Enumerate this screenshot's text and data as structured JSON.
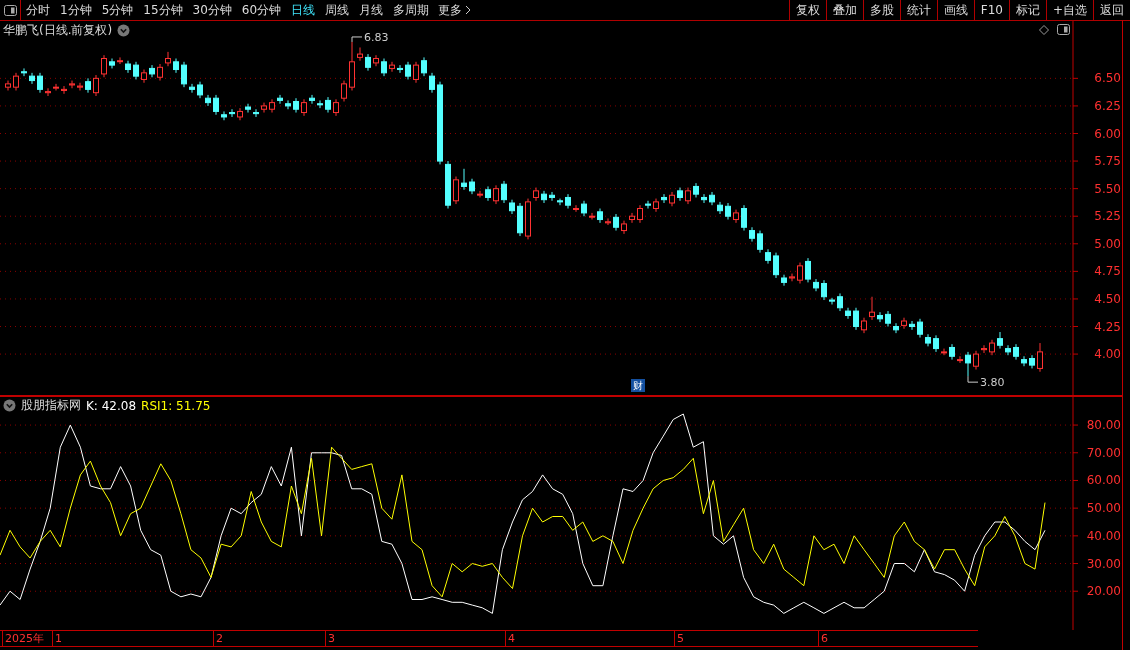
{
  "toolbar": {
    "periods": [
      {
        "label": "分时",
        "selected": false
      },
      {
        "label": "1分钟",
        "selected": false
      },
      {
        "label": "5分钟",
        "selected": false
      },
      {
        "label": "15分钟",
        "selected": false
      },
      {
        "label": "30分钟",
        "selected": false
      },
      {
        "label": "60分钟",
        "selected": false
      },
      {
        "label": "日线",
        "selected": true
      },
      {
        "label": "周线",
        "selected": false
      },
      {
        "label": "月线",
        "selected": false
      },
      {
        "label": "多周期",
        "selected": false
      }
    ],
    "more": "更多",
    "buttons": [
      "复权",
      "叠加",
      "多股",
      "统计",
      "画线",
      "F10",
      "标记",
      "+自选",
      "返回"
    ]
  },
  "price_panel": {
    "title": "华鹏飞(日线.前复权)",
    "high_label": "6.83",
    "low_label": "3.80",
    "badge": "财",
    "chart_data": {
      "type": "candlestick",
      "ylim": [
        3.62,
        7.02
      ],
      "grid": true,
      "yticks": [
        {
          "value": 6.5,
          "label": "6.50"
        },
        {
          "value": 6.25,
          "label": "6.25"
        },
        {
          "value": 6.0,
          "label": "6.00"
        },
        {
          "value": 5.75,
          "label": "5.75"
        },
        {
          "value": 5.5,
          "label": "5.50"
        },
        {
          "value": 5.25,
          "label": "5.25"
        },
        {
          "value": 5.0,
          "label": "5.00"
        },
        {
          "value": 4.75,
          "label": "4.75"
        },
        {
          "value": 4.5,
          "label": "4.50"
        },
        {
          "value": 4.25,
          "label": "4.25"
        },
        {
          "value": 4.0,
          "label": "4.00"
        }
      ],
      "ohlc": [
        [
          6.42,
          6.48,
          6.39,
          6.45
        ],
        [
          6.42,
          6.55,
          6.39,
          6.52
        ],
        [
          6.56,
          6.59,
          6.52,
          6.55
        ],
        [
          6.52,
          6.55,
          6.45,
          6.48
        ],
        [
          6.52,
          6.55,
          6.37,
          6.4
        ],
        [
          6.37,
          6.41,
          6.34,
          6.38
        ],
        [
          6.42,
          6.45,
          6.39,
          6.42
        ],
        [
          6.39,
          6.43,
          6.36,
          6.4
        ],
        [
          6.44,
          6.48,
          6.41,
          6.45
        ],
        [
          6.42,
          6.46,
          6.39,
          6.43
        ],
        [
          6.47,
          6.5,
          6.37,
          6.4
        ],
        [
          6.37,
          6.53,
          6.34,
          6.5
        ],
        [
          6.54,
          6.71,
          6.51,
          6.68
        ],
        [
          6.65,
          6.68,
          6.59,
          6.62
        ],
        [
          6.66,
          6.69,
          6.63,
          6.66
        ],
        [
          6.63,
          6.66,
          6.55,
          6.58
        ],
        [
          6.62,
          6.65,
          6.49,
          6.52
        ],
        [
          6.49,
          6.58,
          6.46,
          6.55
        ],
        [
          6.59,
          6.62,
          6.51,
          6.54
        ],
        [
          6.51,
          6.63,
          6.48,
          6.6
        ],
        [
          6.64,
          6.74,
          6.61,
          6.68
        ],
        [
          6.65,
          6.68,
          6.55,
          6.58
        ],
        [
          6.62,
          6.65,
          6.42,
          6.45
        ],
        [
          6.42,
          6.45,
          6.37,
          6.4
        ],
        [
          6.44,
          6.47,
          6.32,
          6.35
        ],
        [
          6.32,
          6.35,
          6.25,
          6.28
        ],
        [
          6.32,
          6.35,
          6.17,
          6.2
        ],
        [
          6.17,
          6.2,
          6.12,
          6.15
        ],
        [
          6.19,
          6.22,
          6.15,
          6.18
        ],
        [
          6.15,
          6.23,
          6.12,
          6.2
        ],
        [
          6.24,
          6.27,
          6.19,
          6.22
        ],
        [
          6.19,
          6.22,
          6.15,
          6.18
        ],
        [
          6.22,
          6.28,
          6.19,
          6.25
        ],
        [
          6.22,
          6.31,
          6.19,
          6.28
        ],
        [
          6.32,
          6.35,
          6.27,
          6.3
        ],
        [
          6.27,
          6.3,
          6.22,
          6.25
        ],
        [
          6.29,
          6.32,
          6.19,
          6.22
        ],
        [
          6.19,
          6.31,
          6.16,
          6.28
        ],
        [
          6.32,
          6.35,
          6.27,
          6.3
        ],
        [
          6.27,
          6.3,
          6.23,
          6.26
        ],
        [
          6.3,
          6.33,
          6.19,
          6.22
        ],
        [
          6.19,
          6.31,
          6.16,
          6.28
        ],
        [
          6.32,
          6.48,
          6.29,
          6.45
        ],
        [
          6.42,
          6.83,
          6.39,
          6.65
        ],
        [
          6.69,
          6.78,
          6.66,
          6.72
        ],
        [
          6.69,
          6.72,
          6.57,
          6.6
        ],
        [
          6.64,
          6.71,
          6.61,
          6.68
        ],
        [
          6.65,
          6.68,
          6.52,
          6.55
        ],
        [
          6.59,
          6.65,
          6.56,
          6.62
        ],
        [
          6.59,
          6.62,
          6.55,
          6.58
        ],
        [
          6.62,
          6.65,
          6.49,
          6.52
        ],
        [
          6.49,
          6.65,
          6.46,
          6.62
        ],
        [
          6.66,
          6.69,
          6.52,
          6.55
        ],
        [
          6.52,
          6.55,
          6.37,
          6.4
        ],
        [
          6.44,
          6.47,
          5.72,
          5.75
        ],
        [
          5.72,
          5.75,
          5.32,
          5.35
        ],
        [
          5.39,
          5.61,
          5.36,
          5.58
        ],
        [
          5.55,
          5.68,
          5.49,
          5.52
        ],
        [
          5.56,
          5.59,
          5.45,
          5.48
        ],
        [
          5.45,
          5.48,
          5.42,
          5.45
        ],
        [
          5.49,
          5.52,
          5.39,
          5.42
        ],
        [
          5.39,
          5.53,
          5.36,
          5.5
        ],
        [
          5.54,
          5.57,
          5.37,
          5.4
        ],
        [
          5.37,
          5.4,
          5.27,
          5.3
        ],
        [
          5.34,
          5.37,
          5.07,
          5.1
        ],
        [
          5.07,
          5.41,
          5.04,
          5.38
        ],
        [
          5.42,
          5.51,
          5.39,
          5.48
        ],
        [
          5.45,
          5.48,
          5.37,
          5.4
        ],
        [
          5.44,
          5.47,
          5.39,
          5.42
        ],
        [
          5.39,
          5.41,
          5.35,
          5.38
        ],
        [
          5.42,
          5.45,
          5.32,
          5.35
        ],
        [
          5.32,
          5.35,
          5.29,
          5.32
        ],
        [
          5.36,
          5.39,
          5.25,
          5.28
        ],
        [
          5.25,
          5.28,
          5.22,
          5.25
        ],
        [
          5.29,
          5.32,
          5.19,
          5.22
        ],
        [
          5.19,
          5.23,
          5.17,
          5.2
        ],
        [
          5.24,
          5.27,
          5.12,
          5.15
        ],
        [
          5.12,
          5.21,
          5.09,
          5.18
        ],
        [
          5.22,
          5.28,
          5.19,
          5.25
        ],
        [
          5.22,
          5.35,
          5.19,
          5.32
        ],
        [
          5.36,
          5.39,
          5.32,
          5.35
        ],
        [
          5.32,
          5.41,
          5.29,
          5.38
        ],
        [
          5.42,
          5.45,
          5.37,
          5.4
        ],
        [
          5.37,
          5.47,
          5.34,
          5.44
        ],
        [
          5.48,
          5.51,
          5.39,
          5.42
        ],
        [
          5.39,
          5.51,
          5.36,
          5.48
        ],
        [
          5.52,
          5.55,
          5.42,
          5.45
        ],
        [
          5.42,
          5.45,
          5.37,
          5.4
        ],
        [
          5.44,
          5.47,
          5.35,
          5.38
        ],
        [
          5.35,
          5.38,
          5.27,
          5.3
        ],
        [
          5.34,
          5.37,
          5.22,
          5.25
        ],
        [
          5.22,
          5.31,
          5.19,
          5.28
        ],
        [
          5.32,
          5.35,
          5.12,
          5.15
        ],
        [
          5.12,
          5.15,
          5.02,
          5.05
        ],
        [
          5.09,
          5.12,
          4.92,
          4.95
        ],
        [
          4.92,
          4.95,
          4.82,
          4.85
        ],
        [
          4.89,
          4.92,
          4.69,
          4.72
        ],
        [
          4.69,
          4.72,
          4.62,
          4.65
        ],
        [
          4.69,
          4.73,
          4.66,
          4.7
        ],
        [
          4.67,
          4.83,
          4.64,
          4.8
        ],
        [
          4.84,
          4.87,
          4.65,
          4.68
        ],
        [
          4.65,
          4.68,
          4.57,
          4.6
        ],
        [
          4.64,
          4.67,
          4.49,
          4.52
        ],
        [
          4.49,
          4.51,
          4.45,
          4.48
        ],
        [
          4.52,
          4.55,
          4.39,
          4.42
        ],
        [
          4.39,
          4.42,
          4.32,
          4.35
        ],
        [
          4.39,
          4.42,
          4.22,
          4.25
        ],
        [
          4.22,
          4.33,
          4.19,
          4.3
        ],
        [
          4.34,
          4.52,
          4.31,
          4.38
        ],
        [
          4.35,
          4.38,
          4.29,
          4.32
        ],
        [
          4.36,
          4.39,
          4.25,
          4.28
        ],
        [
          4.25,
          4.28,
          4.19,
          4.22
        ],
        [
          4.26,
          4.33,
          4.23,
          4.3
        ],
        [
          4.27,
          4.3,
          4.22,
          4.25
        ],
        [
          4.29,
          4.32,
          4.15,
          4.18
        ],
        [
          4.15,
          4.18,
          4.07,
          4.1
        ],
        [
          4.14,
          4.17,
          4.02,
          4.05
        ],
        [
          4.02,
          4.05,
          3.99,
          4.02
        ],
        [
          4.06,
          4.09,
          3.95,
          3.98
        ],
        [
          3.95,
          3.98,
          3.92,
          3.95
        ],
        [
          3.99,
          4.02,
          3.8,
          3.92
        ],
        [
          3.89,
          4.03,
          3.86,
          4.0
        ],
        [
          4.04,
          4.08,
          4.01,
          4.05
        ],
        [
          4.02,
          4.13,
          3.99,
          4.1
        ],
        [
          4.14,
          4.2,
          4.05,
          4.08
        ],
        [
          4.05,
          4.08,
          3.99,
          4.02
        ],
        [
          4.06,
          4.09,
          3.95,
          3.98
        ],
        [
          3.95,
          3.98,
          3.89,
          3.92
        ],
        [
          3.96,
          3.99,
          3.87,
          3.9
        ],
        [
          3.87,
          4.1,
          3.84,
          4.02
        ]
      ]
    }
  },
  "indicator_panel": {
    "name": "股朋指标网",
    "readouts": [
      {
        "label": "K: 42.08",
        "color": "#ffffff"
      },
      {
        "label": "RSI1: 51.75",
        "color": "#ffff00"
      }
    ],
    "chart_data": {
      "type": "line",
      "ylim": [
        6,
        90.5
      ],
      "grid": true,
      "yticks": [
        {
          "value": 80,
          "label": "80.00"
        },
        {
          "value": 70,
          "label": "70.00"
        },
        {
          "value": 60,
          "label": "60.00"
        },
        {
          "value": 50,
          "label": "50.00"
        },
        {
          "value": 40,
          "label": "40.00"
        },
        {
          "value": 30,
          "label": "30.00"
        },
        {
          "value": 20,
          "label": "20.00"
        }
      ],
      "series": [
        {
          "color": "#ffffff",
          "values": [
            15,
            20,
            17,
            28,
            38,
            50,
            72,
            80,
            72,
            58,
            57,
            57,
            65,
            58,
            42,
            35,
            33,
            20,
            18,
            19,
            18,
            25,
            40,
            50,
            48,
            52,
            55,
            65,
            58,
            72,
            40,
            70,
            70,
            70,
            69,
            57,
            57,
            55,
            38,
            37,
            30,
            17,
            17,
            18,
            17,
            16,
            16,
            15,
            14,
            12,
            35,
            45,
            53,
            56,
            62,
            57,
            55,
            48,
            30,
            22,
            22,
            40,
            57,
            56,
            60,
            70,
            76,
            82,
            84,
            72,
            74,
            40,
            37,
            40,
            25,
            18,
            16,
            15,
            12,
            14,
            16,
            14,
            12,
            14,
            16,
            14,
            14,
            17,
            20,
            30,
            30,
            27,
            35,
            27,
            26,
            24,
            20,
            33,
            40,
            45,
            45,
            42,
            38,
            35,
            42
          ]
        },
        {
          "color": "#ffff00",
          "values": [
            33,
            42,
            36,
            32,
            38,
            42,
            36,
            50,
            62,
            67,
            58,
            52,
            40,
            48,
            50,
            58,
            66,
            60,
            48,
            35,
            32,
            25,
            37,
            36,
            40,
            56,
            45,
            38,
            36,
            58,
            48,
            68,
            40,
            72,
            68,
            64,
            65,
            66,
            50,
            46,
            62,
            38,
            35,
            22,
            18,
            30,
            27,
            30,
            29,
            30,
            25,
            21,
            40,
            50,
            45,
            47,
            47,
            42,
            45,
            38,
            40,
            38,
            30,
            42,
            50,
            57,
            60,
            61,
            64,
            68,
            48,
            60,
            38,
            44,
            50,
            35,
            30,
            37,
            28,
            25,
            22,
            40,
            35,
            37,
            30,
            40,
            35,
            30,
            25,
            40,
            45,
            38,
            35,
            28,
            35,
            35,
            28,
            22,
            36,
            40,
            47,
            40,
            30,
            28,
            52
          ]
        }
      ]
    }
  },
  "date_axis": [
    "2025年",
    "1",
    "2",
    "3",
    "4",
    "5",
    "6"
  ]
}
